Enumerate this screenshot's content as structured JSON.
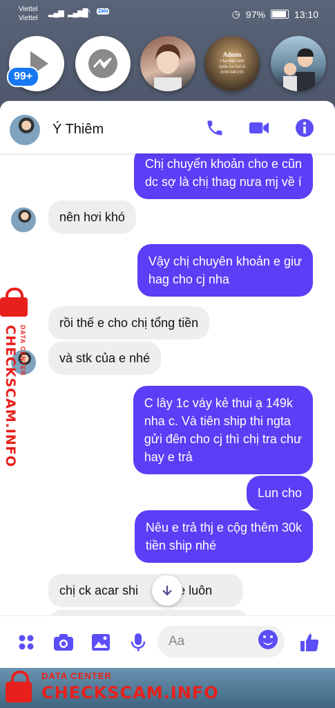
{
  "status_bar": {
    "carrier1": "Viettel",
    "carrier2": "Viettel",
    "zalo": "Zalo",
    "battery": "97%",
    "time": "13:10"
  },
  "chat_heads": {
    "badge": "99+",
    "admin_title": "Admin",
    "admin_line1": "Chợ Điện Mới",
    "admin_line2": "Quần Áo Giá Sỉ",
    "admin_phone": "0359 648 235"
  },
  "conversation": {
    "contact_name": "Ý Thiêm",
    "composer_placeholder": "Aa"
  },
  "messages": [
    {
      "dir": "out",
      "text_lines": [
        "Chị chuyển khoản cho e cũn",
        "dc sợ là chị thag nưa mj về í"
      ]
    },
    {
      "dir": "in",
      "text_lines": [
        "nên hơi khó"
      ]
    },
    {
      "dir": "out",
      "text_lines": [
        "Vậy chị chuyên khoản e giư",
        "hag cho cj nha"
      ]
    },
    {
      "dir": "in",
      "text_lines": [
        "rồi thế e cho chị tổng tiền"
      ]
    },
    {
      "dir": "in",
      "text_lines": [
        "và stk của e nhé"
      ]
    },
    {
      "dir": "out",
      "text_lines": [
        "C lây 1c váy kẻ thui ạ 149k",
        "nha c. Và tiên ship thi ngta",
        "gửi đên cho cj thì chị tra chư",
        "hay e trả"
      ]
    },
    {
      "dir": "out",
      "text_lines": [
        "Lun cho"
      ]
    },
    {
      "dir": "out",
      "text_lines": [
        "Nêu e trả thj e cộg thêm 30k",
        "tiền ship nhé"
      ]
    },
    {
      "dir": "in",
      "text_lines": [
        "chị ck acar shi",
        "o e luôn"
      ]
    }
  ],
  "watermark": {
    "small": "DATA CENTER",
    "big": "CHECKSCAM.INFO"
  },
  "colors": {
    "accent": "#5b3ef5",
    "incoming_bubble": "#eeeeee",
    "watermark": "#e8201c"
  }
}
